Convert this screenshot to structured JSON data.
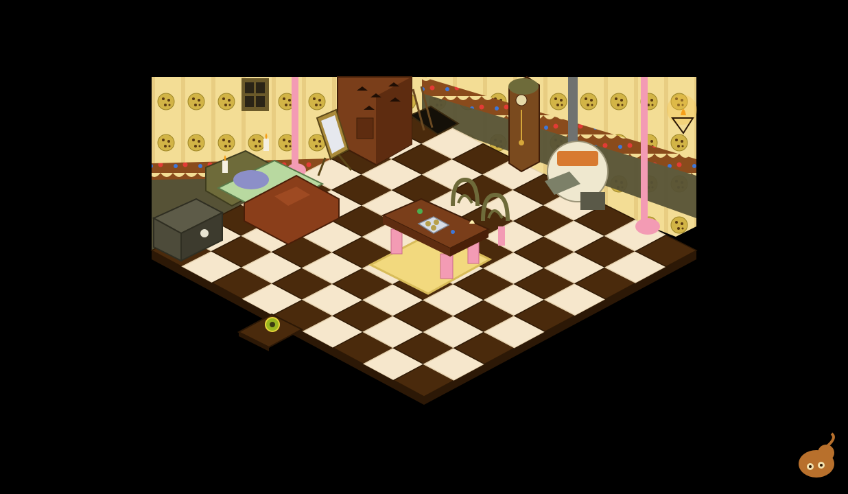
{
  "room": {
    "palette": {
      "background": "#000000",
      "wallpaper": "#f3dd95",
      "wallpaper_shadow": "#e3c579",
      "wall_trim": "#8a4b1c",
      "wainscot": "#565236",
      "tile_light": "#f6e7cc",
      "tile_dark": "#4a2a0c",
      "floor_edge": "#2c1806",
      "candy_pink": "#f39bb4",
      "gumdrop_red": "#e23b35",
      "gumdrop_blue": "#3e77d8",
      "wood": "#7a3e1a",
      "wood_light": "#a85a28",
      "chest": "#4d4b3a",
      "stove_stone": "#efe8cf",
      "rug": "#f2d97e",
      "mascot": "#b8702c"
    },
    "floor": {
      "grid_cols": 9,
      "grid_rows": 9
    },
    "objects": {
      "cookie-wallpaper": "cookie-pattern",
      "wall-window": "window-icon",
      "wardrobe": "wardrobe-icon",
      "floor-hatch": "trapdoor-icon",
      "grandfather-clock": "clock-icon",
      "wood-stove": "stove-icon",
      "wall-torch": "torch-icon",
      "dripping-candy-left": "candy-drip-icon",
      "dripping-candy-right": "candy-drip-icon",
      "standing-mirror": "mirror-icon",
      "bed": "bed-icon",
      "nightstand-candles": "candle-icon",
      "storage-chest": "chest-icon",
      "rug": "rug-icon",
      "candy-table": "table-icon",
      "cookie-plate": "plate-icon",
      "chair-left": "chair-icon",
      "chair-right": "chair-icon",
      "exit-tile": "exit-sun-icon",
      "corner-mascot": "mascot-icon"
    }
  }
}
